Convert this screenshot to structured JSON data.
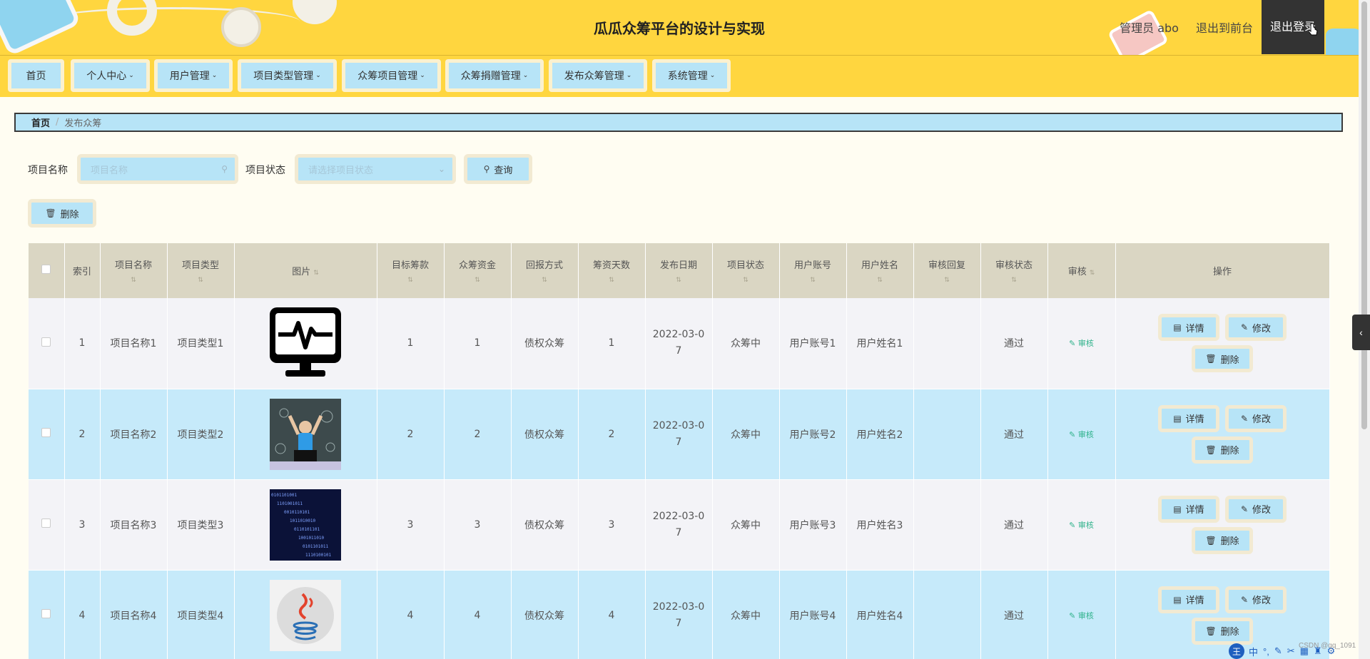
{
  "header": {
    "title": "瓜瓜众筹平台的设计与实现",
    "admin_label": "管理员 abo",
    "front_link": "退出到前台",
    "logout": "退出登录"
  },
  "menu": [
    {
      "label": "首页",
      "has_arrow": false
    },
    {
      "label": "个人中心",
      "has_arrow": true
    },
    {
      "label": "用户管理",
      "has_arrow": true
    },
    {
      "label": "项目类型管理",
      "has_arrow": true
    },
    {
      "label": "众筹项目管理",
      "has_arrow": true
    },
    {
      "label": "众筹捐赠管理",
      "has_arrow": true
    },
    {
      "label": "发布众筹管理",
      "has_arrow": true
    },
    {
      "label": "系统管理",
      "has_arrow": true
    }
  ],
  "breadcrumb": {
    "home": "首页",
    "current": "发布众筹"
  },
  "search": {
    "name_label": "项目名称",
    "name_placeholder": "项目名称",
    "status_label": "项目状态",
    "status_placeholder": "请选择项目状态",
    "query_button": "查询"
  },
  "toolbar": {
    "delete_button": "删除"
  },
  "table": {
    "columns": [
      "索引",
      "项目名称",
      "项目类型",
      "图片",
      "目标筹款",
      "众筹资金",
      "回报方式",
      "筹资天数",
      "发布日期",
      "项目状态",
      "用户账号",
      "用户姓名",
      "审核回复",
      "审核状态",
      "审核",
      "操作"
    ],
    "rows": [
      {
        "index": "1",
        "name": "项目名称1",
        "type": "项目类型1",
        "image": "monitor-heartbeat-image",
        "target": "1",
        "funds": "1",
        "reward": "债权众筹",
        "days": "1",
        "date_a": "2022-03-0",
        "date_b": "7",
        "status": "众筹中",
        "account": "用户账号1",
        "username": "用户姓名1",
        "reply": "",
        "audit_status": "通过",
        "audit": "审核"
      },
      {
        "index": "2",
        "name": "项目名称2",
        "type": "项目类型2",
        "image": "child-laptop-image",
        "target": "2",
        "funds": "2",
        "reward": "债权众筹",
        "days": "2",
        "date_a": "2022-03-0",
        "date_b": "7",
        "status": "众筹中",
        "account": "用户账号2",
        "username": "用户姓名2",
        "reply": "",
        "audit_status": "通过",
        "audit": "审核"
      },
      {
        "index": "3",
        "name": "项目名称3",
        "type": "项目类型3",
        "image": "binary-code-image",
        "target": "3",
        "funds": "3",
        "reward": "债权众筹",
        "days": "3",
        "date_a": "2022-03-0",
        "date_b": "7",
        "status": "众筹中",
        "account": "用户账号3",
        "username": "用户姓名3",
        "reply": "",
        "audit_status": "通过",
        "audit": "审核"
      },
      {
        "index": "4",
        "name": "项目名称4",
        "type": "项目类型4",
        "image": "java-logo-image",
        "target": "4",
        "funds": "4",
        "reward": "债权众筹",
        "days": "4",
        "date_a": "2022-03-0",
        "date_b": "7",
        "status": "众筹中",
        "account": "用户账号4",
        "username": "用户姓名4",
        "reply": "",
        "audit_status": "通过",
        "audit": "审核"
      }
    ],
    "op_detail": "详情",
    "op_edit": "修改",
    "op_delete": "删除"
  },
  "ime": {
    "logo": "王",
    "mode": "中"
  },
  "watermark": "CSDN @qq_1091",
  "colors": {
    "header_bg": "#ffd63f",
    "button_bg": "#b7e4f7",
    "row_even": "#c6eafa",
    "row_odd": "#f3f3f7",
    "audit_link": "#2fb28b"
  }
}
